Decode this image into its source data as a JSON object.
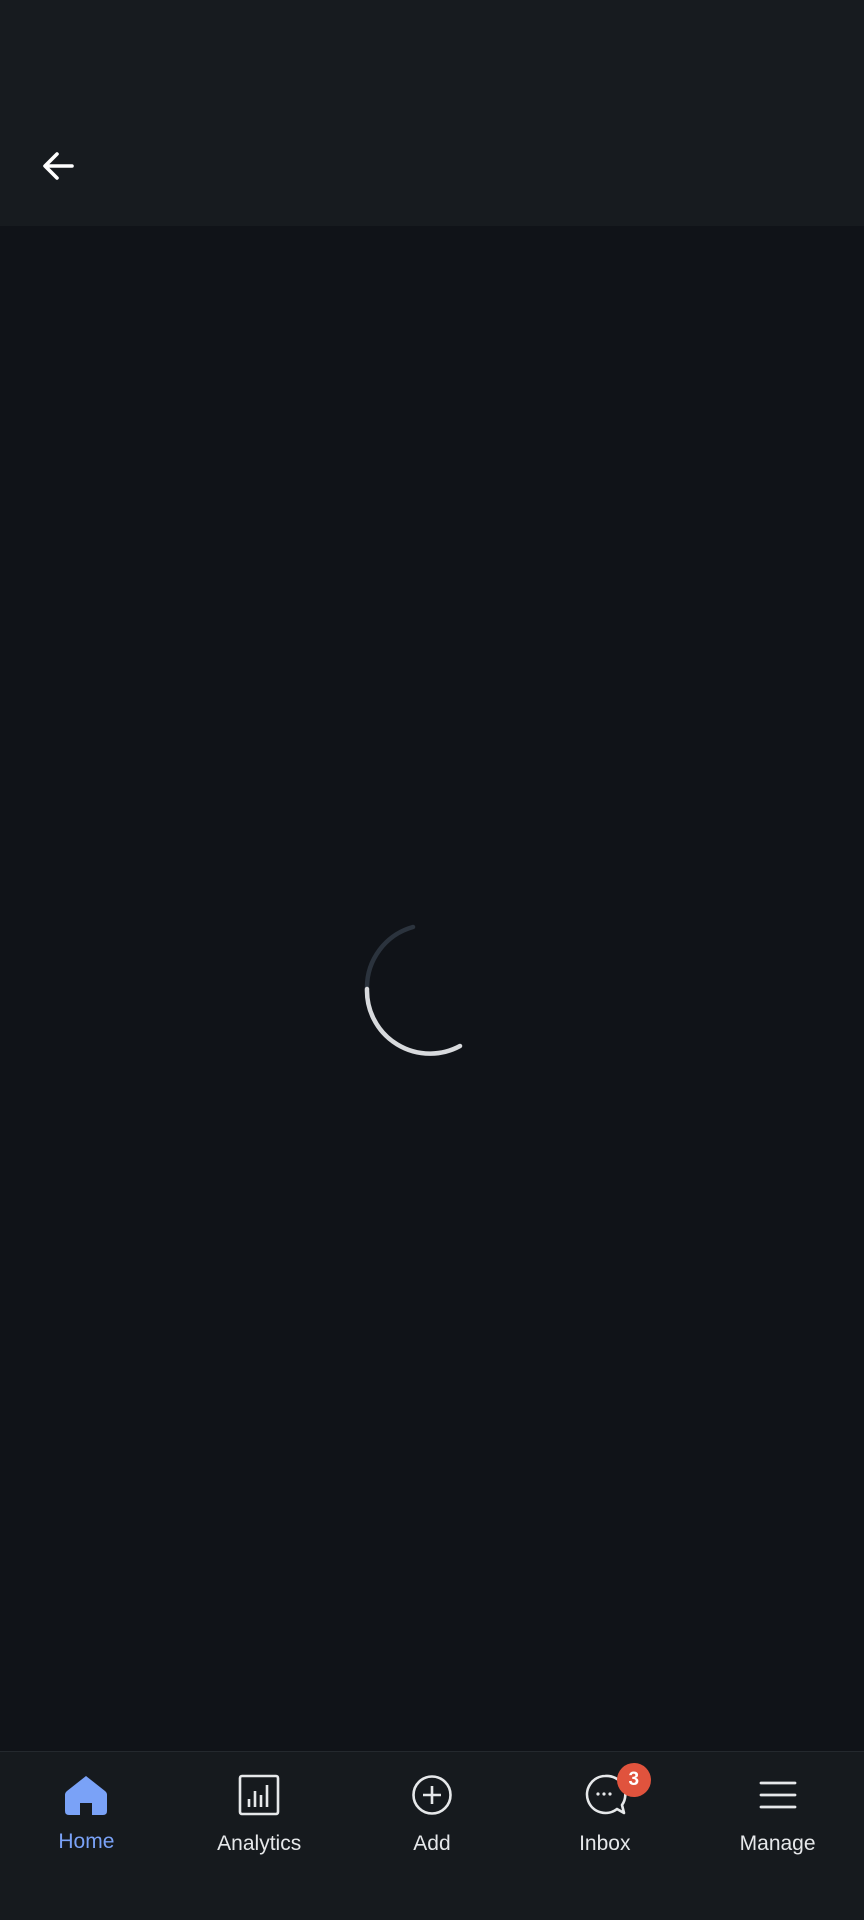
{
  "header": {
    "back_icon": "arrow-left-icon"
  },
  "main": {
    "loading_indicator": "spinner"
  },
  "colors": {
    "background": "#101318",
    "top_bar": "#171b1f",
    "bottom_nav": "#161a1e",
    "accent": "#7aa2f7",
    "badge": "#e0533d"
  },
  "bottom_nav": {
    "items": [
      {
        "label": "Home",
        "icon": "home-icon",
        "active": true
      },
      {
        "label": "Analytics",
        "icon": "analytics-icon",
        "active": false
      },
      {
        "label": "Add",
        "icon": "plus-circle-icon",
        "active": false
      },
      {
        "label": "Inbox",
        "icon": "chat-bubble-icon",
        "active": false,
        "badge": "3"
      },
      {
        "label": "Manage",
        "icon": "menu-icon",
        "active": false
      }
    ]
  }
}
